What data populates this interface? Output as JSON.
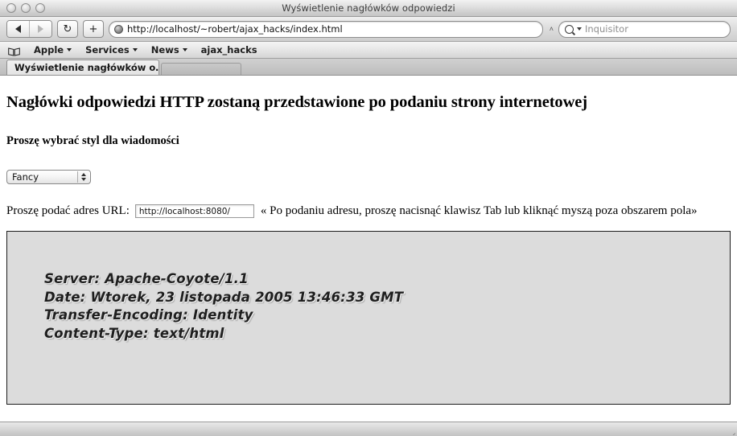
{
  "window": {
    "title": "Wyświetlenie nagłówków odpowiedzi",
    "traffic_lights": [
      "close",
      "minimize",
      "zoom"
    ]
  },
  "toolbar": {
    "back_icon": "back-arrow-icon",
    "forward_icon": "forward-arrow-icon",
    "reload_label": "↻",
    "add_label": "+",
    "url_value": "http://localhost/~robert/ajax_hacks/index.html",
    "url_caret": "˄",
    "search_placeholder": "Inquisitor"
  },
  "bookmarks": {
    "items": [
      {
        "label": "Apple",
        "has_menu": true
      },
      {
        "label": "Services",
        "has_menu": true
      },
      {
        "label": "News",
        "has_menu": true
      },
      {
        "label": "ajax_hacks",
        "has_menu": false
      }
    ]
  },
  "tabs": {
    "active_label": "Wyświetlenie nagłówków o…"
  },
  "page": {
    "heading": "Nagłówki odpowiedzi HTTP zostaną przedstawione po podaniu strony internetowej",
    "subheading": "Proszę wybrać styl dla wiadomości",
    "style_select": {
      "value": "Fancy"
    },
    "url_row": {
      "label": "Proszę podać adres URL:",
      "input_value": "http://localhost:8080/",
      "input_placeholder": "",
      "hint": "« Po podaniu adresu, proszę nacisnąć klawisz Tab lub kliknąć myszą poza obszarem pola»"
    },
    "headers": [
      "Server: Apache-Coyote/1.1",
      "Date: Wtorek, 23 listopada 2005 13:46:33 GMT",
      "Transfer-Encoding: Identity",
      "Content-Type: text/html"
    ]
  },
  "colors": {
    "headers_box_bg": "#dcdcdc",
    "headers_box_border": "#1c1c1c",
    "chrome_bg": "#dedede",
    "text": "#000000"
  }
}
